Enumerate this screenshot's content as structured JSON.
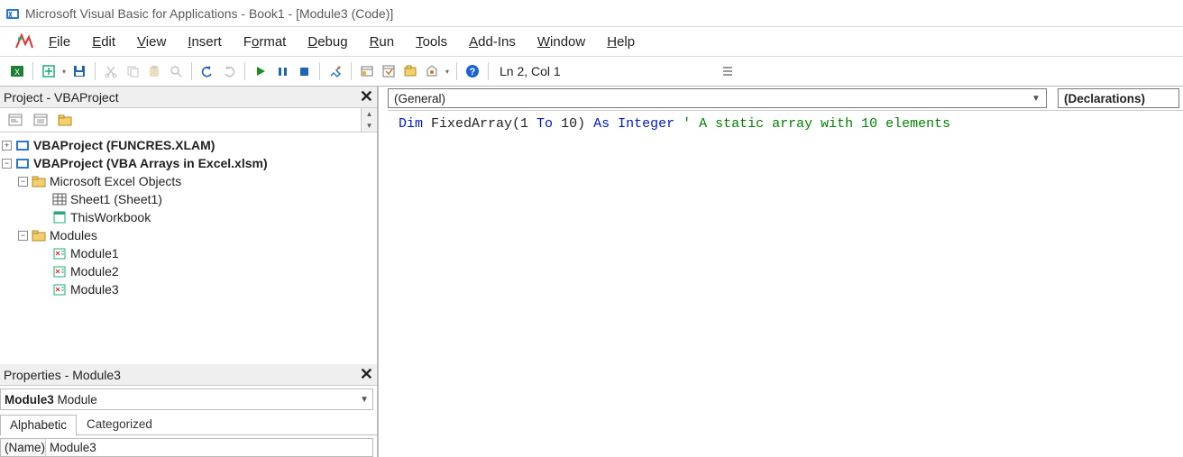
{
  "title": "Microsoft Visual Basic for Applications - Book1 - [Module3 (Code)]",
  "menus": {
    "file": "File",
    "edit": "Edit",
    "view": "View",
    "insert": "Insert",
    "format": "Format",
    "debug": "Debug",
    "run": "Run",
    "tools": "Tools",
    "addins": "Add-Ins",
    "window": "Window",
    "help": "Help"
  },
  "toolbar": {
    "status": "Ln 2, Col 1"
  },
  "project_panel": {
    "title": "Project - VBAProject",
    "nodes": {
      "funcres": "VBAProject (FUNCRES.XLAM)",
      "arrays": "VBAProject (VBA Arrays in Excel.xlsm)",
      "excel_objs": "Microsoft Excel Objects",
      "sheet1": "Sheet1 (Sheet1)",
      "thiswb": "ThisWorkbook",
      "modules": "Modules",
      "m1": "Module1",
      "m2": "Module2",
      "m3": "Module3"
    }
  },
  "properties_panel": {
    "title": "Properties - Module3",
    "object_name": "Module3",
    "object_type": "Module",
    "tabs": {
      "alpha": "Alphabetic",
      "cat": "Categorized"
    },
    "row": {
      "name_key": "(Name)",
      "name_val": "Module3"
    }
  },
  "code_pane": {
    "object_combo": "(General)",
    "proc_combo": "(Declarations)",
    "code": {
      "kw1": "Dim ",
      "id": "FixedArray(1 ",
      "kw2": "To ",
      "id2": "10) ",
      "kw3": "As Integer ",
      "cm": "' A static array with 10 elements"
    }
  }
}
